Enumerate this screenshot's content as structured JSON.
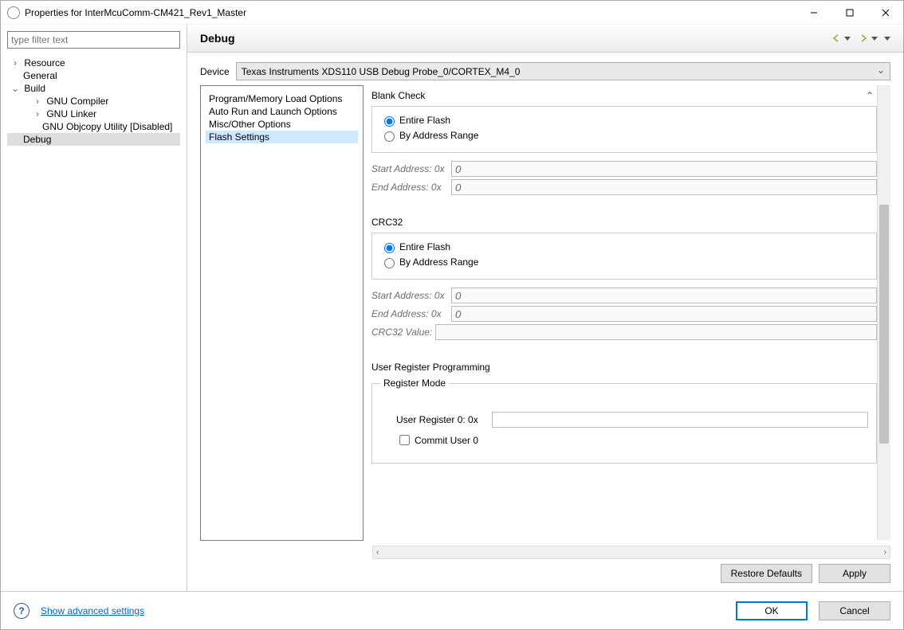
{
  "window": {
    "title": "Properties for InterMcuComm-CM421_Rev1_Master"
  },
  "filter_placeholder": "type filter text",
  "tree": {
    "resource": "Resource",
    "general": "General",
    "build": "Build",
    "gnu_compiler": "GNU Compiler",
    "gnu_linker": "GNU Linker",
    "gnu_objcopy": "GNU Objcopy Utility  [Disabled]",
    "debug": "Debug"
  },
  "header": {
    "title": "Debug"
  },
  "device": {
    "label": "Device",
    "value": "Texas Instruments XDS110 USB Debug Probe_0/CORTEX_M4_0"
  },
  "categories": {
    "program_memory": "Program/Memory Load Options",
    "auto_run": "Auto Run and Launch Options",
    "misc": "Misc/Other Options",
    "flash": "Flash Settings"
  },
  "settings": {
    "blank_check": {
      "title": "Blank Check",
      "entire_flash": "Entire Flash",
      "by_address": "By Address Range",
      "start_label": "Start Address: 0x",
      "start_value": "0",
      "end_label": "End Address: 0x",
      "end_value": "0"
    },
    "crc32": {
      "title": "CRC32",
      "entire_flash": "Entire Flash",
      "by_address": "By Address Range",
      "start_label": "Start Address: 0x",
      "start_value": "0",
      "end_label": "End Address: 0x",
      "end_value": "0",
      "crc_label": "CRC32 Value:",
      "crc_value": ""
    },
    "user_reg": {
      "title": "User Register Programming",
      "mode_title": "Register Mode",
      "reg0_label": "User Register 0: 0x",
      "reg0_value": "",
      "commit0": "Commit User 0"
    }
  },
  "buttons": {
    "restore": "Restore Defaults",
    "apply": "Apply",
    "ok": "OK",
    "cancel": "Cancel"
  },
  "footer": {
    "show_advanced": "Show advanced settings"
  }
}
